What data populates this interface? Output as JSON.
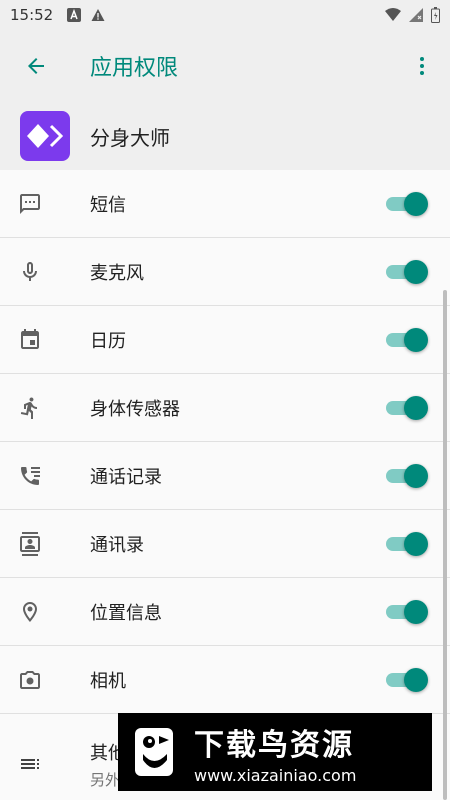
{
  "statusbar": {
    "time": "15:52"
  },
  "appbar": {
    "title": "应用权限",
    "back_icon": "arrow-back-icon",
    "more_icon": "more-vert-icon"
  },
  "app": {
    "name": "分身大师",
    "icon_color": "#7c3aed"
  },
  "colors": {
    "accent": "#00897b",
    "track": "#80cbc4"
  },
  "permissions": [
    {
      "label": "短信",
      "icon": "sms-icon",
      "enabled": true
    },
    {
      "label": "麦克风",
      "icon": "microphone-icon",
      "enabled": true
    },
    {
      "label": "日历",
      "icon": "calendar-icon",
      "enabled": true
    },
    {
      "label": "身体传感器",
      "icon": "body-sensor-icon",
      "enabled": true
    },
    {
      "label": "通话记录",
      "icon": "call-log-icon",
      "enabled": true
    },
    {
      "label": "通讯录",
      "icon": "contacts-icon",
      "enabled": true
    },
    {
      "label": "位置信息",
      "icon": "location-icon",
      "enabled": true
    },
    {
      "label": "相机",
      "icon": "camera-icon",
      "enabled": true
    }
  ],
  "other": {
    "label": "其他",
    "subtitle": "另外"
  },
  "watermark": {
    "title": "下载鸟资源",
    "url": "www.xiazainiao.com"
  }
}
